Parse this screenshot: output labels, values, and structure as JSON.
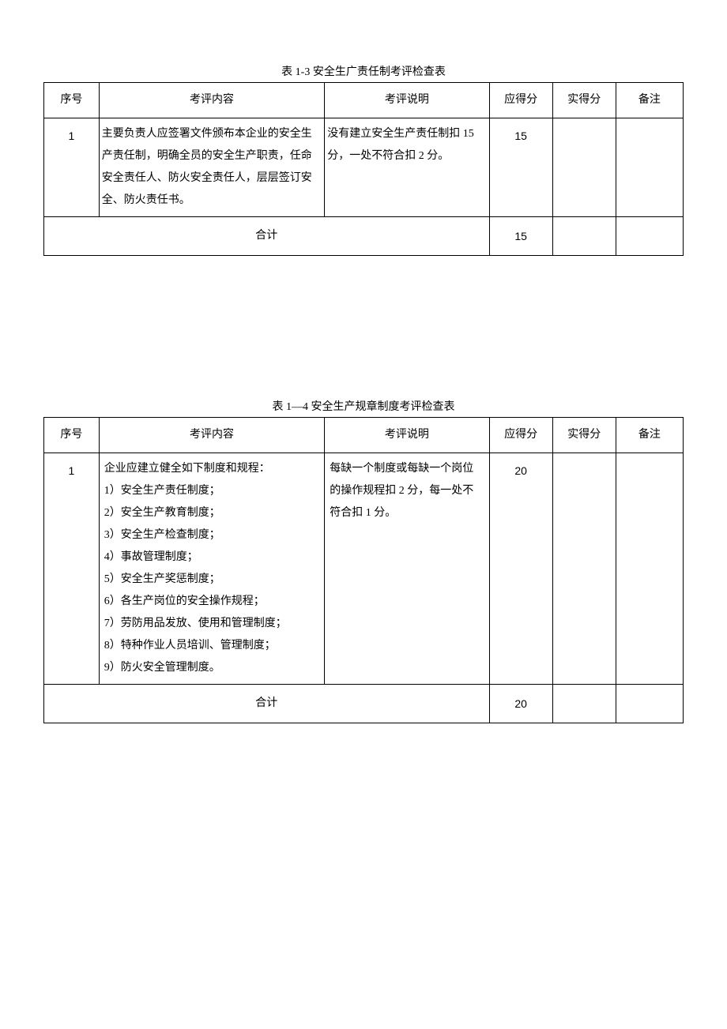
{
  "table1": {
    "title": "表 1-3 安全生广责任制考评检查表",
    "headers": {
      "seq": "序号",
      "content": "考评内容",
      "desc": "考评说明",
      "score": "应得分",
      "actual": "实得分",
      "remark": "备注"
    },
    "rows": [
      {
        "seq": "1",
        "content": "主要负责人应签署文件颁布本企业的安全生产责任制，明确全员的安全生产职责，任命安全责任人、防火安全责任人，层层签订安全、防火责任书。",
        "desc": "没有建立安全生产责任制扣 15 分，一处不符合扣 2 分。",
        "score": "15",
        "actual": "",
        "remark": ""
      }
    ],
    "sum_label": "合计",
    "sum_score": "15"
  },
  "table2": {
    "title": "表 1—4 安全生产规章制度考评检查表",
    "headers": {
      "seq": "序号",
      "content": "考评内容",
      "desc": "考评说明",
      "score": "应得分",
      "actual": "实得分",
      "remark": "备注"
    },
    "rows": [
      {
        "seq": "1",
        "content_lines": [
          "企业应建立健全如下制度和规程：",
          "1）安全生产责任制度；",
          "2）安全生产教育制度；",
          "3）安全生产检查制度；",
          "4）事故管理制度；",
          "5）安全生产奖惩制度；",
          "6）各生产岗位的安全操作规程；",
          "7）劳防用品发放、使用和管理制度；",
          "8）特种作业人员培训、管理制度；",
          "9）防火安全管理制度。"
        ],
        "desc": "每缺一个制度或每缺一个岗位的操作规程扣 2 分，每一处不符合扣 1 分。",
        "score": "20",
        "actual": "",
        "remark": ""
      }
    ],
    "sum_label": "合计",
    "sum_score": "20"
  }
}
